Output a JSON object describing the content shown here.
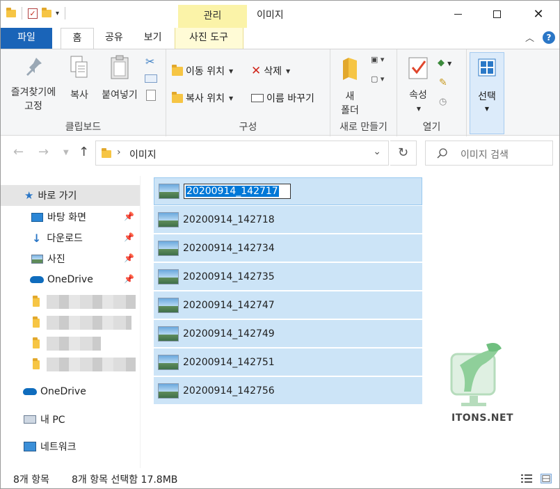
{
  "window": {
    "title": "이미지",
    "context_group_label": "관리"
  },
  "tabs": [
    {
      "label": "파일"
    },
    {
      "label": "홈"
    },
    {
      "label": "공유"
    },
    {
      "label": "보기"
    },
    {
      "label": "사진 도구"
    }
  ],
  "ribbon": {
    "clipboard": {
      "group_label": "클립보드",
      "pin_label_1": "즐겨찾기에",
      "pin_label_2": "고정",
      "copy_label": "복사",
      "paste_label": "붙여넣기"
    },
    "organize": {
      "group_label": "구성",
      "move_to": "이동 위치",
      "copy_to": "복사 위치",
      "delete": "삭제",
      "rename": "이름 바꾸기"
    },
    "new": {
      "group_label": "새로 만들기",
      "new_folder_1": "새",
      "new_folder_2": "폴더"
    },
    "open": {
      "group_label": "열기",
      "properties": "속성"
    },
    "select": {
      "label": "선택"
    }
  },
  "address": {
    "path_item": "이미지",
    "search_placeholder": "이미지 검색"
  },
  "nav_pane": {
    "quick_access": "바로 가기",
    "desktop": "바탕 화면",
    "downloads": "다운로드",
    "pictures": "사진",
    "onedrive_pinned": "OneDrive",
    "onedrive": "OneDrive",
    "this_pc": "내 PC",
    "network": "네트워크"
  },
  "files": [
    {
      "name": "20200914_142717"
    },
    {
      "name": "20200914_142718"
    },
    {
      "name": "20200914_142734"
    },
    {
      "name": "20200914_142735"
    },
    {
      "name": "20200914_142747"
    },
    {
      "name": "20200914_142749"
    },
    {
      "name": "20200914_142751"
    },
    {
      "name": "20200914_142756"
    }
  ],
  "watermark": {
    "text": "ITONS.NET"
  },
  "status": {
    "item_count": "8개 항목",
    "selection": "8개 항목 선택함 17.8MB"
  },
  "icons": {
    "folder": "folder-icon",
    "image": "image-file-icon",
    "pin": "pin-icon",
    "star": "star-icon",
    "cloud": "onedrive-icon",
    "pc": "computer-icon",
    "network": "network-icon"
  },
  "colors": {
    "file_tab": "#1a64b8",
    "context_tab": "#fbf3a8",
    "selection": "#cce4f7",
    "select_button": "#dcebfa"
  }
}
